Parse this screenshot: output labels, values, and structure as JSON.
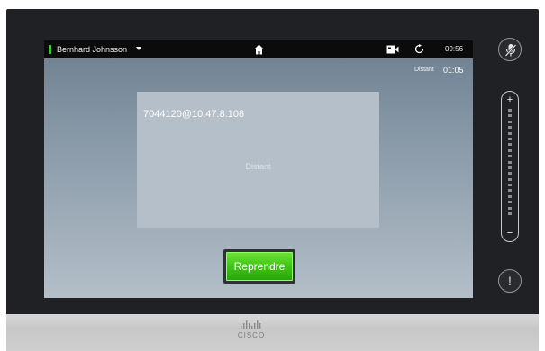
{
  "topbar": {
    "user_name": "Bernhard Johnsson",
    "time": "09:56",
    "icons": [
      "caret-down-icon",
      "home-icon",
      "video-camera-icon",
      "refresh-icon"
    ]
  },
  "call": {
    "label": "Distant",
    "timer": "01:05",
    "address": "7044120@10.47.8.108",
    "status": "Distant"
  },
  "actions": {
    "resume_label": "Reprendre"
  },
  "sidebar": {
    "mic_icon": "microphone-muted-icon",
    "alert_label": "!",
    "volume_plus": "+",
    "volume_minus": "−"
  },
  "footer": {
    "brand": "CISCO"
  },
  "colors": {
    "accent_green": "#3ec516",
    "status_indicator": "#39c23c"
  }
}
